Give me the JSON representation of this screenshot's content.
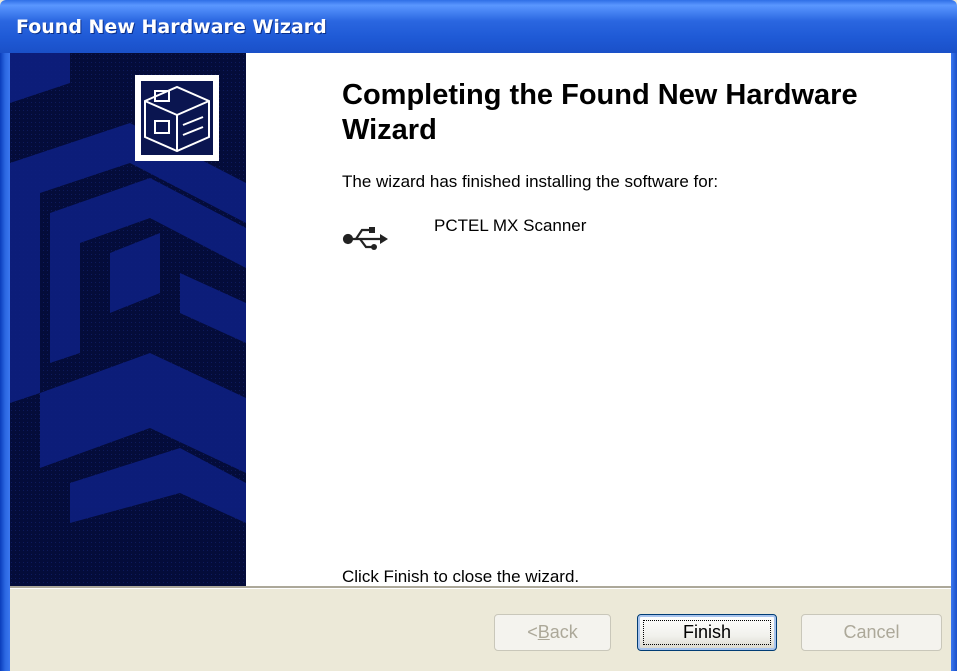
{
  "window": {
    "title": "Found New Hardware Wizard"
  },
  "sidebar": {
    "icon": "hardware-box-icon"
  },
  "content": {
    "heading": "Completing the Found New Hardware Wizard",
    "intro": "The wizard has finished installing the software for:",
    "device": {
      "icon": "usb-icon",
      "name": "PCTEL MX Scanner"
    },
    "close_hint": "Click Finish to close the wizard."
  },
  "buttons": {
    "back_prefix": "< ",
    "back_mnemonic": "B",
    "back_rest": "ack",
    "back_enabled": false,
    "finish": "Finish",
    "finish_enabled": true,
    "cancel": "Cancel",
    "cancel_enabled": false
  },
  "colors": {
    "titlebar": "#2a66e0",
    "sidebar": "#040c3a",
    "dialog_face": "#ECE9D8",
    "disabled_text": "#ACA899"
  }
}
